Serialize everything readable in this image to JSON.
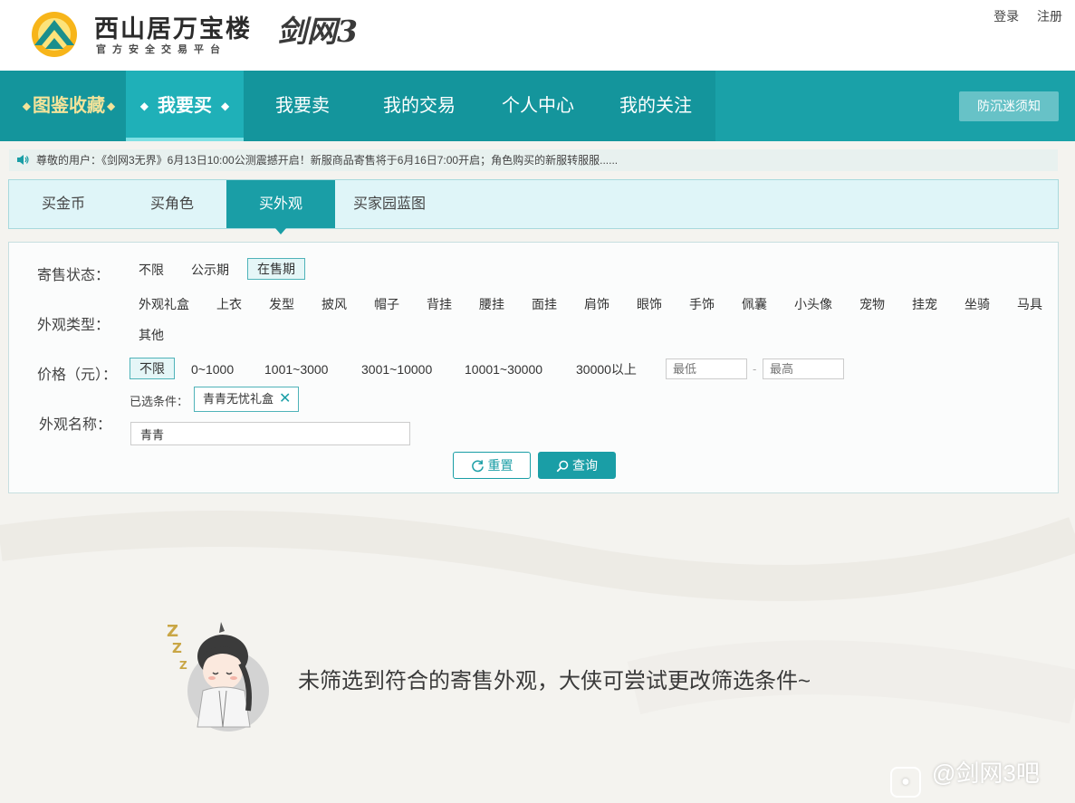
{
  "header": {
    "title": "西山居万宝楼",
    "subtitle": "官方安全交易平台",
    "game_logo": "剑网3",
    "login": "登录",
    "register": "注册"
  },
  "nav": {
    "items": [
      {
        "label": "图鉴收藏"
      },
      {
        "label": "我要买"
      },
      {
        "label": "我要卖"
      },
      {
        "label": "我的交易"
      },
      {
        "label": "个人中心"
      },
      {
        "label": "我的关注"
      }
    ],
    "anti_addiction": "防沉迷须知"
  },
  "notice": {
    "text": "尊敬的用户：《剑网3无界》6月13日10:00公测震撼开启！新服商品寄售将于6月16日7:00开启；角色购买的新服转服服......"
  },
  "subtabs": [
    {
      "label": "买金币"
    },
    {
      "label": "买角色"
    },
    {
      "label": "买外观"
    },
    {
      "label": "买家园蓝图"
    }
  ],
  "filter": {
    "status_label": "寄售状态：",
    "status_options": [
      "不限",
      "公示期",
      "在售期"
    ],
    "status_selected": "在售期",
    "type_label": "外观类型：",
    "type_options": [
      "外观礼盒",
      "上衣",
      "发型",
      "披风",
      "帽子",
      "背挂",
      "腰挂",
      "面挂",
      "肩饰",
      "眼饰",
      "手饰",
      "佩囊",
      "小头像",
      "宠物",
      "挂宠",
      "坐骑",
      "马具",
      "其他"
    ],
    "price_label": "价格（元）：",
    "price_options": [
      "不限",
      "0~1000",
      "1001~3000",
      "3001~10000",
      "10001~30000",
      "30000以上"
    ],
    "price_selected": "不限",
    "price_min_placeholder": "最低",
    "price_max_placeholder": "最高",
    "price_dash": "-",
    "selected_label": "已选条件：",
    "selected_chip": "青青无忧礼盒",
    "name_label": "外观名称：",
    "name_value": "青青",
    "reset_label": "重置",
    "query_label": "查询"
  },
  "empty_state": {
    "message": "未筛选到符合的寄售外观，大侠可尝试更改筛选条件~"
  },
  "watermark": {
    "text": "@剑网3吧"
  },
  "colors": {
    "accent": "#1a9ea6",
    "nav_bg": "#1aa1a8",
    "gold": "#f3e39a"
  }
}
